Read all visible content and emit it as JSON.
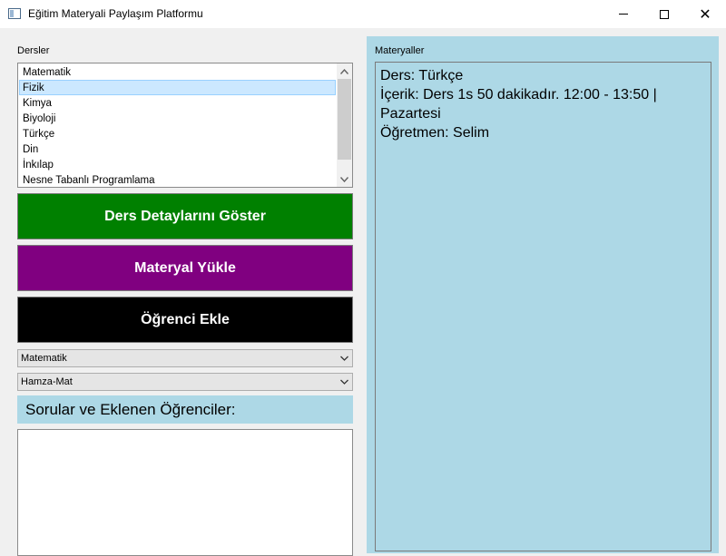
{
  "window": {
    "title": "Eğitim Materyali Paylaşım Platformu",
    "minimize_glyph": "—",
    "maximize_glyph": "☐",
    "close_glyph": "✕"
  },
  "courses": {
    "label": "Dersler",
    "items": [
      "Matematik",
      "Fizik",
      "Kimya",
      "Biyoloji",
      "Türkçe",
      "Din",
      "İnkılap",
      "Nesne Tabanlı Programlama"
    ],
    "selected_index": 1,
    "scroll_up_glyph": "▲",
    "scroll_down_glyph": "▼"
  },
  "buttons": {
    "details": {
      "label": "Ders Detaylarını Göster",
      "color": "#008000"
    },
    "upload": {
      "label": "Materyal Yükle",
      "color": "#800080"
    },
    "add_student": {
      "label": "Öğrenci Ekle",
      "color": "#000000"
    }
  },
  "combos": {
    "course": {
      "value": "Matematik"
    },
    "student": {
      "value": "Hamza-Mat"
    },
    "arrow_glyph": "▼"
  },
  "questions": {
    "header": "Sorular ve Eklenen Öğrenciler:",
    "header_color": "#add8e6"
  },
  "materials": {
    "label": "Materyaller",
    "background": "#add8e6",
    "lines": [
      "Ders: Türkçe",
      "İçerik: Ders 1s 50 dakikadır. 12:00 - 13:50 | Pazartesi",
      "Öğretmen: Selim"
    ]
  }
}
